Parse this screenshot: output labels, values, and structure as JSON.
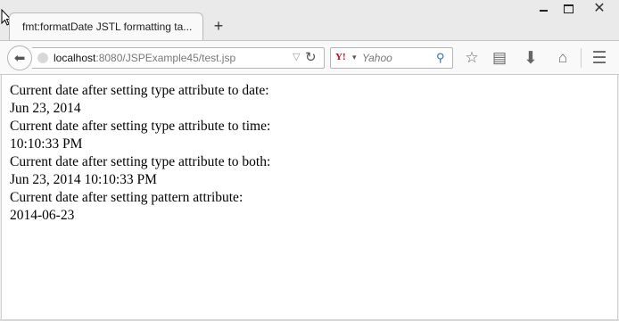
{
  "window": {
    "minimize_icon": "minimize-icon",
    "maximize_icon": "maximize-icon",
    "close_icon": "close-icon"
  },
  "tab": {
    "title": "fmt:formatDate JSTL formatting ta...",
    "new_tab_symbol": "+"
  },
  "navbar": {
    "url_host": "localhost",
    "url_rest": ":8080/JSPExample45/test.jsp",
    "search_placeholder": "Yahoo",
    "search_engine_logo": "Y!"
  },
  "content": {
    "lines": [
      "Current date after setting type attribute to date:",
      "Jun 23, 2014",
      "Current date after setting type attribute to time:",
      "10:10:33 PM",
      "Current date after setting type attribute to both:",
      "Jun 23, 2014 10:10:33 PM",
      "Current date after setting pattern attribute:",
      "2014-06-23"
    ]
  },
  "colors": {
    "chrome_bg": "#f0f0f0",
    "page_bg": "#ffffff",
    "yahoo_red": "#d0021b",
    "search_icon_blue": "#2c6fbf"
  }
}
